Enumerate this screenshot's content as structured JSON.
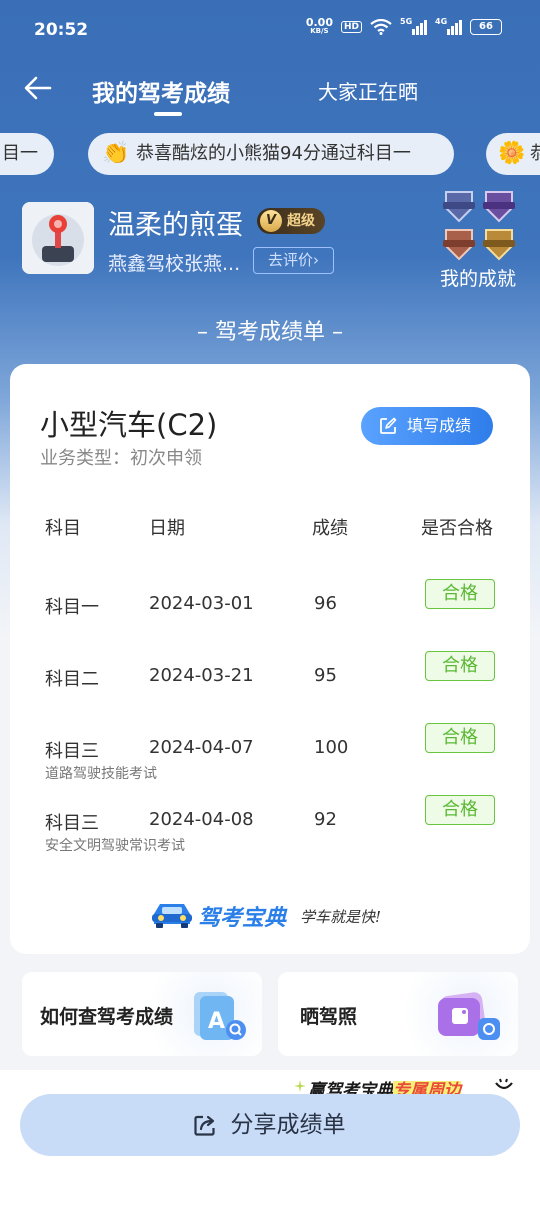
{
  "status_bar": {
    "time": "20:52",
    "net_speed_value": "0.00",
    "net_speed_unit": "KB/S",
    "hd": "HD",
    "sig1": "5G",
    "sig2": "4G",
    "battery": "66"
  },
  "nav": {
    "active_tab": "我的驾考成绩",
    "other_tab": "大家正在晒"
  },
  "ticker": {
    "left": "目一",
    "main": "恭喜酷炫的小熊猫94分通过科目一",
    "right": "恭"
  },
  "profile": {
    "username": "温柔的煎蛋",
    "vip_letter": "V",
    "vip_label": "超级",
    "school": "燕鑫驾校张燕...",
    "rate_button": "去评价",
    "achievements_label": "我的成就"
  },
  "sheet_title": "– 驾考成绩单 –",
  "card": {
    "vehicle": "小型汽车(C2)",
    "business_type": "业务类型：初次申领",
    "fill_button": "填写成绩",
    "headers": [
      "科目",
      "日期",
      "成绩",
      "是否合格"
    ],
    "rows": [
      {
        "subject": "科目一",
        "date": "2024-03-01",
        "score": "96",
        "status": "合格",
        "note": ""
      },
      {
        "subject": "科目二",
        "date": "2024-03-21",
        "score": "95",
        "status": "合格",
        "note": ""
      },
      {
        "subject": "科目三",
        "date": "2024-04-07",
        "score": "100",
        "status": "合格",
        "note": "道路驾驶技能考试"
      },
      {
        "subject": "科目三",
        "date": "2024-04-08",
        "score": "92",
        "status": "合格",
        "note": "安全文明驾驶常识考试"
      }
    ],
    "brand_name": "驾考宝典",
    "brand_slogan": "学车就是快!"
  },
  "tiles": {
    "left": "如何查驾考成绩",
    "right": "晒驾照"
  },
  "promo": {
    "prefix": "赢驾考宝典",
    "highlight": "专属周边"
  },
  "share_button": "分享成绩单",
  "colors": {
    "primary_blue": "#3a6fb8",
    "pass_green": "#5bb834",
    "button_blue": "#2f7dea"
  }
}
